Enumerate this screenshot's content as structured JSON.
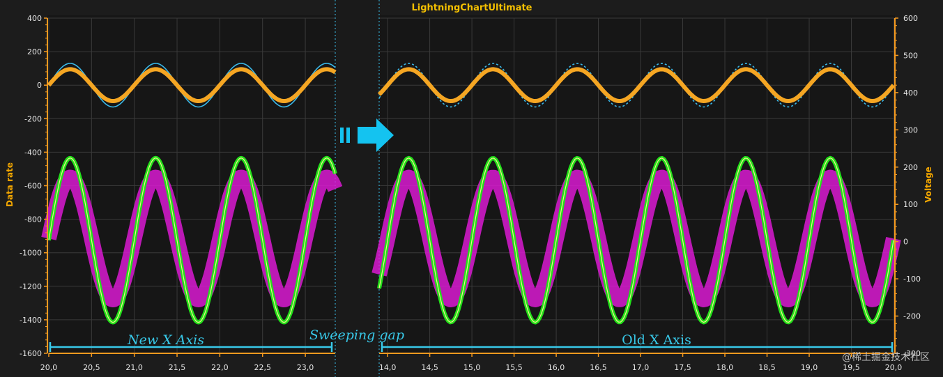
{
  "chart_data": {
    "type": "line",
    "title": "LightningChartUltimate",
    "ylabel": "Data rate",
    "y2label": "Voltage",
    "ylim": [
      -1600,
      400
    ],
    "y2lim": [
      -300,
      600
    ],
    "yticks": [
      "400",
      "200",
      "0",
      "-200",
      "-400",
      "-600",
      "-800",
      "-1000",
      "-1200",
      "-1400",
      "-1600"
    ],
    "y2ticks": [
      "600",
      "500",
      "400",
      "300",
      "200",
      "100",
      "0",
      "-100",
      "-200",
      "-300"
    ],
    "new_x_axis": {
      "label": "New X Axis",
      "range": [
        20.0,
        23.35
      ],
      "ticks": [
        "20,0",
        "20,5",
        "21,0",
        "21,5",
        "22,0",
        "22,5",
        "23,0"
      ]
    },
    "old_x_axis": {
      "label": "Old X Axis",
      "range": [
        13.9,
        20.0
      ],
      "ticks": [
        "14,0",
        "14,5",
        "15,0",
        "15,5",
        "16,0",
        "16,5",
        "17,0",
        "17,5",
        "18,0",
        "18,5",
        "19,0",
        "19,5",
        "20,0"
      ]
    },
    "sweeping_gap_label": "Sweeping gap",
    "grid": true,
    "series": [
      {
        "color": "#3ab8e8",
        "style": "solid-new / dotted-old",
        "center": 0,
        "amplitude": 130,
        "period": 1.0,
        "axis": "left"
      },
      {
        "color": "#f5a623",
        "center": 0,
        "amplitude": 95,
        "period": 1.0,
        "axis": "left"
      },
      {
        "color": "#22e01a",
        "center": -925,
        "amplitude": 490,
        "period": 1.0,
        "axis": "left"
      },
      {
        "color": "#e01ad8",
        "center": -915,
        "amplitude": 365,
        "period": 1.0,
        "axis": "left"
      }
    ],
    "colors": {
      "background": "#161616",
      "grid": "#3a3a3a",
      "axis": "#f59a20",
      "arrow": "#14c3f0"
    }
  },
  "watermark": "@稀土掘金技术社区"
}
